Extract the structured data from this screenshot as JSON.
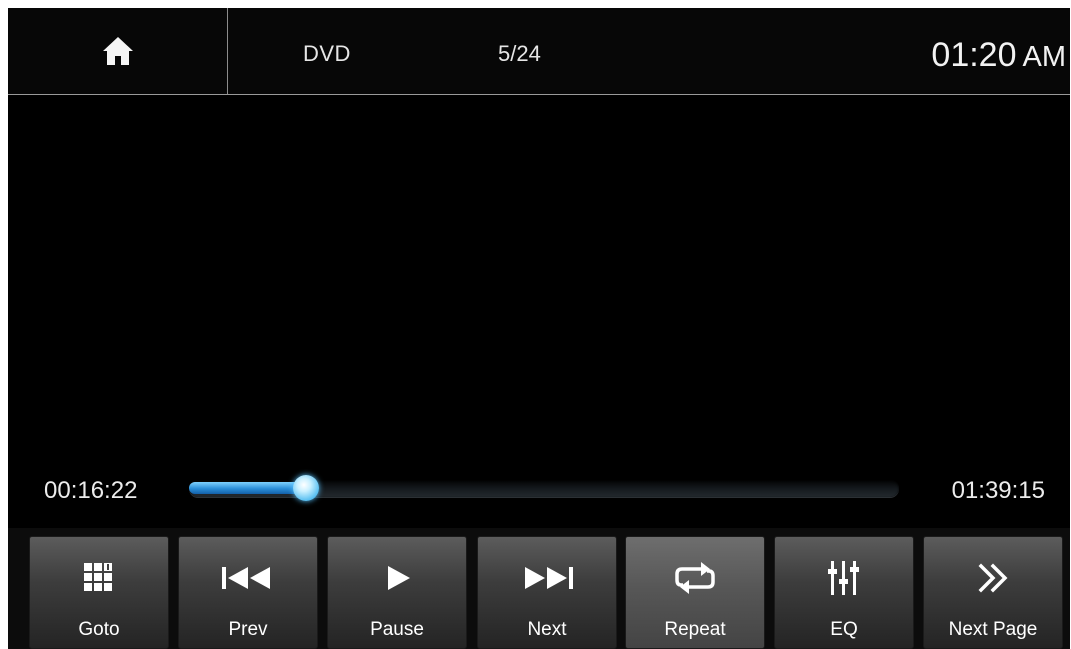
{
  "header": {
    "home_icon": "home-icon",
    "source": "DVD",
    "track": "5/24",
    "clock": {
      "time": "01:20",
      "ampm": "AM"
    }
  },
  "playback": {
    "elapsed": "00:16:22",
    "total": "01:39:15",
    "progress_fraction": 0.165
  },
  "buttons": [
    {
      "id": "goto",
      "label": "Goto",
      "icon": "grid-keypad-icon"
    },
    {
      "id": "prev",
      "label": "Prev",
      "icon": "skip-previous-icon"
    },
    {
      "id": "pause",
      "label": "Pause",
      "icon": "play-icon"
    },
    {
      "id": "next",
      "label": "Next",
      "icon": "skip-next-icon"
    },
    {
      "id": "repeat",
      "label": "Repeat",
      "icon": "repeat-icon",
      "active": true
    },
    {
      "id": "eq",
      "label": "EQ",
      "icon": "equalizer-icon"
    },
    {
      "id": "next-page",
      "label": "Next Page",
      "icon": "double-chevron-right-icon"
    }
  ],
  "colors": {
    "background": "#000000",
    "progress_fill": "#2a8fd9",
    "text": "#ececec"
  }
}
